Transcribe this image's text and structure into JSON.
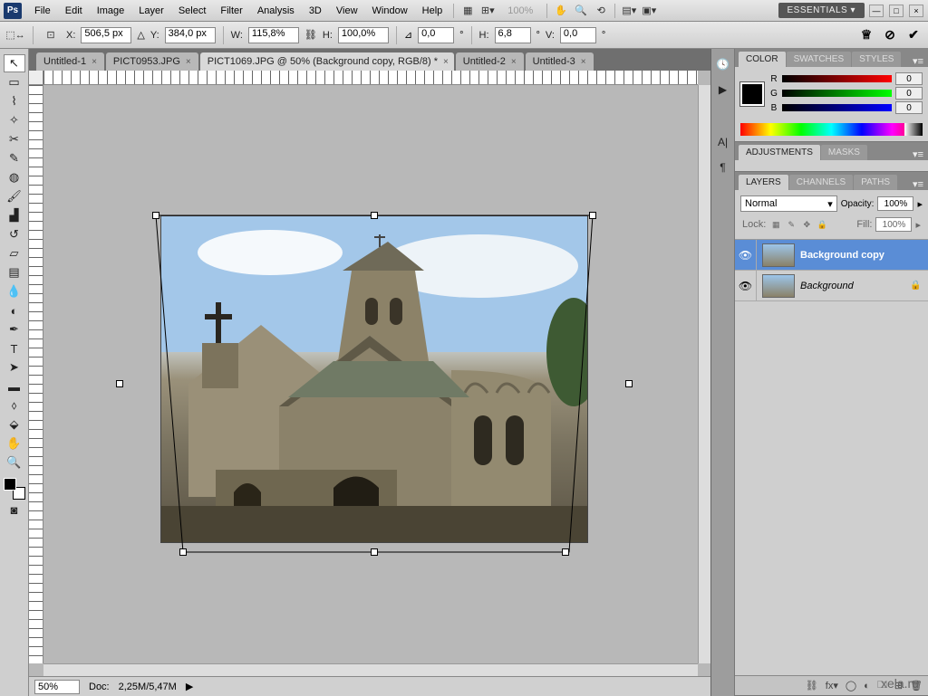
{
  "app": {
    "logo": "Ps",
    "workspace": "ESSENTIALS ▾"
  },
  "menu": [
    "File",
    "Edit",
    "Image",
    "Layer",
    "Select",
    "Filter",
    "Analysis",
    "3D",
    "View",
    "Window",
    "Help"
  ],
  "zoom_display": "100%",
  "options": {
    "x_label": "X:",
    "x": "506,5 px",
    "y_label": "Y:",
    "y": "384,0 px",
    "w_label": "W:",
    "w": "115,8%",
    "h_label": "H:",
    "h": "100,0%",
    "angle_label": "⊿",
    "angle": "0,0",
    "hskew_label": "H:",
    "hskew": "6,8",
    "vskew_label": "V:",
    "vskew": "0,0",
    "deg": "°"
  },
  "tabs": [
    {
      "label": "Untitled-1",
      "active": false
    },
    {
      "label": "PICT0953.JPG",
      "active": false
    },
    {
      "label": "PICT1069.JPG @ 50% (Background copy, RGB/8) *",
      "active": true
    },
    {
      "label": "Untitled-2",
      "active": false
    },
    {
      "label": "Untitled-3",
      "active": false
    }
  ],
  "status": {
    "zoom": "50%",
    "doc_label": "Doc:",
    "doc": "2,25M/5,47M"
  },
  "panels": {
    "color": {
      "tabs": [
        "COLOR",
        "SWATCHES",
        "STYLES"
      ],
      "r_label": "R",
      "g_label": "G",
      "b_label": "B",
      "r": "0",
      "g": "0",
      "b": "0"
    },
    "adjustments": {
      "tabs": [
        "ADJUSTMENTS",
        "MASKS"
      ]
    },
    "layers": {
      "tabs": [
        "LAYERS",
        "CHANNELS",
        "PATHS"
      ],
      "blend": "Normal",
      "opacity_label": "Opacity:",
      "opacity": "100%",
      "lock_label": "Lock:",
      "fill_label": "Fill:",
      "fill": "100%",
      "items": [
        {
          "name": "Background copy",
          "selected": true,
          "locked": false
        },
        {
          "name": "Background",
          "selected": false,
          "locked": true
        }
      ]
    }
  },
  "watermark": "xela.ru"
}
